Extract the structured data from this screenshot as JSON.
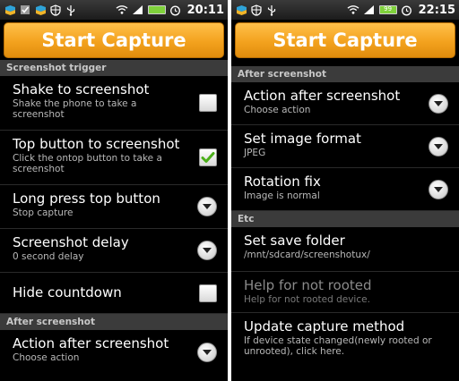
{
  "left_screen": {
    "status": {
      "time": "20:11",
      "battery_level": "",
      "notification_icons": [
        "app-notification-icon",
        "checkbox-notification-icon",
        "app-notification-icon",
        "shield-notification-icon",
        "usb-icon"
      ],
      "system_icons": [
        "wifi-icon",
        "signal-icon",
        "battery-icon",
        "alarm-icon"
      ]
    },
    "capture_button": "Start Capture",
    "sections": [
      {
        "header": "Screenshot trigger",
        "items": [
          {
            "title": "Shake to screenshot",
            "summary": "Shake the phone to take a screenshot",
            "widget": "checkbox",
            "checked": false
          },
          {
            "title": "Top button to screenshot",
            "summary": "Click the ontop button to take a screenshot",
            "widget": "checkbox",
            "checked": true
          },
          {
            "title": "Long press top button",
            "summary": "Stop capture",
            "widget": "dropdown"
          },
          {
            "title": "Screenshot delay",
            "summary": "0 second delay",
            "widget": "dropdown"
          },
          {
            "title": "Hide countdown",
            "summary": "",
            "widget": "checkbox",
            "checked": false
          }
        ]
      },
      {
        "header": "After screenshot",
        "items": [
          {
            "title": "Action after screenshot",
            "summary": "Choose action",
            "widget": "dropdown"
          }
        ]
      }
    ]
  },
  "right_screen": {
    "status": {
      "time": "22:15",
      "battery_level": "99",
      "notification_icons": [
        "app-notification-icon",
        "shield-notification-icon",
        "usb-icon"
      ],
      "system_icons": [
        "wifi-icon",
        "signal-icon",
        "battery-icon",
        "alarm-icon"
      ]
    },
    "capture_button": "Start Capture",
    "sections": [
      {
        "header": "After screenshot",
        "items": [
          {
            "title": "Action after screenshot",
            "summary": "Choose action",
            "widget": "dropdown"
          },
          {
            "title": "Set image format",
            "summary": "JPEG",
            "widget": "dropdown"
          },
          {
            "title": "Rotation fix",
            "summary": "Image is normal",
            "widget": "dropdown"
          }
        ]
      },
      {
        "header": "Etc",
        "items": [
          {
            "title": "Set save folder",
            "summary": "/mnt/sdcard/screenshotux/",
            "widget": "none"
          },
          {
            "title": "Help for not rooted",
            "summary": "Help for not rooted device.",
            "widget": "none",
            "disabled": true
          },
          {
            "title": "Update capture method",
            "summary": "If device state changed(newly rooted or unrooted), click here.",
            "widget": "none"
          }
        ]
      }
    ]
  },
  "colors": {
    "capture_button": "#f3a21e",
    "check_green": "#4caf1a",
    "section_header_bg": "#3b3b3b",
    "background": "#000000"
  }
}
